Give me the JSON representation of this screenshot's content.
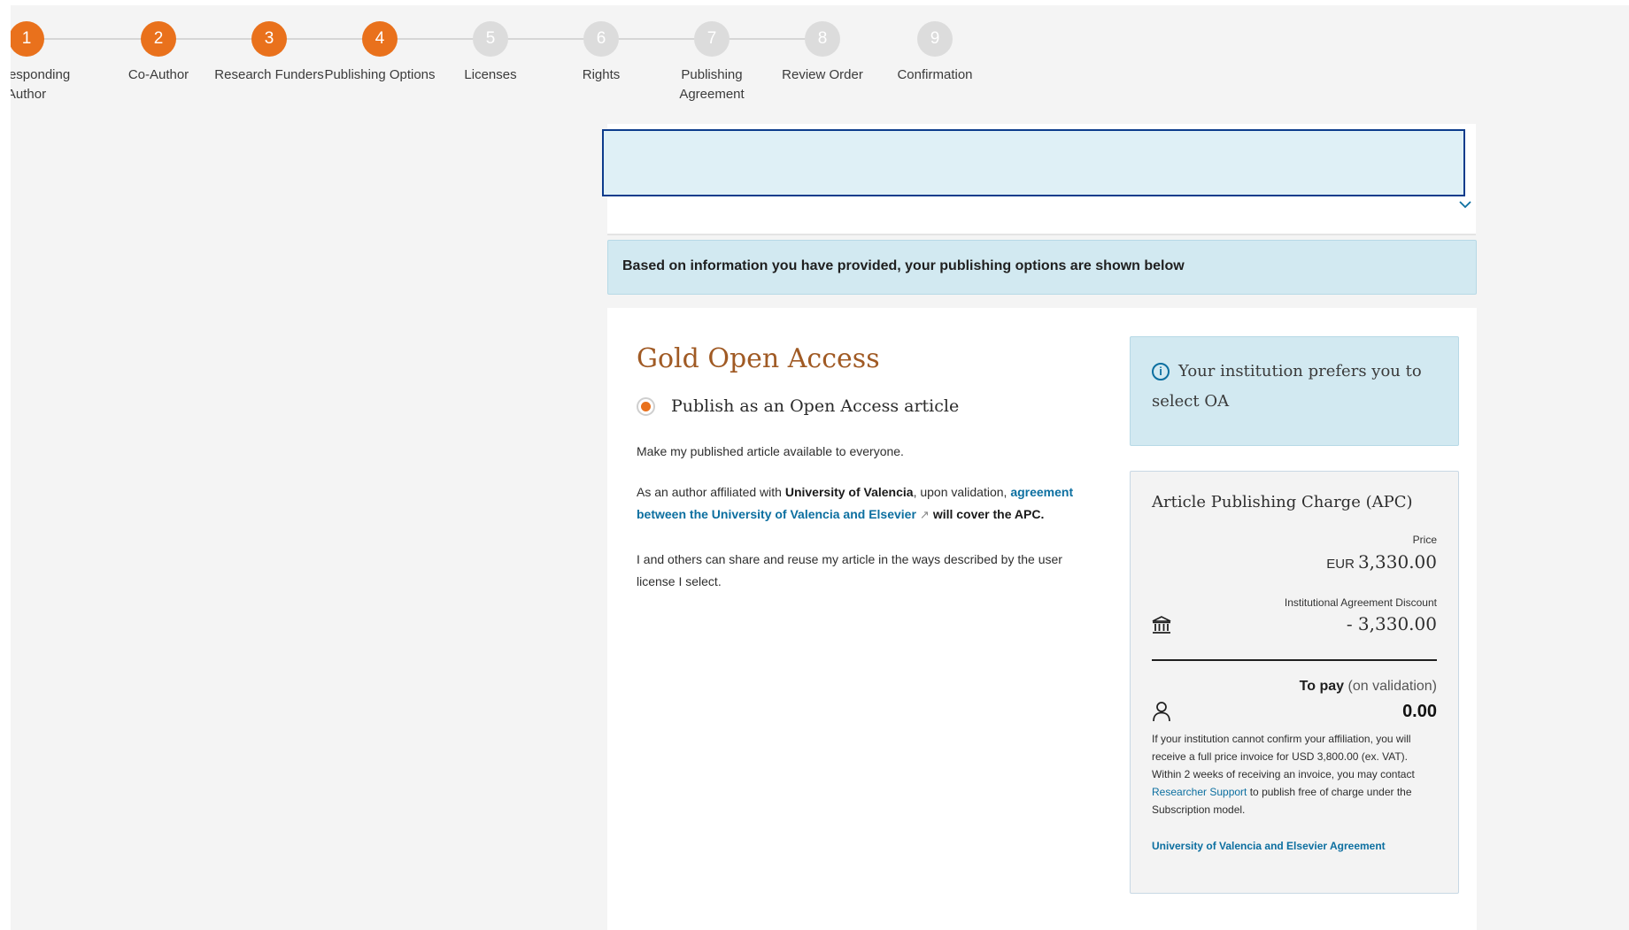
{
  "stepper": {
    "steps": [
      {
        "num": "1",
        "label": "Corresponding Author",
        "state": "done"
      },
      {
        "num": "2",
        "label": "Co-Author",
        "state": "done"
      },
      {
        "num": "3",
        "label": "Research Funders",
        "state": "done"
      },
      {
        "num": "4",
        "label": "Publishing Options",
        "state": "current"
      },
      {
        "num": "5",
        "label": "Licenses",
        "state": "todo"
      },
      {
        "num": "6",
        "label": "Rights",
        "state": "todo"
      },
      {
        "num": "7",
        "label": "Publishing Agreement",
        "state": "todo"
      },
      {
        "num": "8",
        "label": "Review Order",
        "state": "todo"
      },
      {
        "num": "9",
        "label": "Confirmation",
        "state": "todo"
      }
    ]
  },
  "banner": {
    "text": "Based on information you have provided, your publishing options are shown below"
  },
  "option": {
    "title": "Gold Open Access",
    "radio_label": "Publish as an Open Access article",
    "desc1": "Make my published article available to everyone.",
    "desc2_a": "As an author affiliated with ",
    "desc2_b": "University of Valencia",
    "desc2_c": ", upon validation, ",
    "desc2_link": "agreement between the University of Valencia and Elsevier",
    "desc2_d": "will cover the APC.",
    "desc3": "I and others can share and reuse my article in the ways described by the user license I select."
  },
  "preference": {
    "text": "Your institution prefers you to select OA"
  },
  "apc": {
    "title": "Article Publishing Charge (APC)",
    "price_label": "Price",
    "currency": "EUR",
    "price": "3,330.00",
    "discount_label": "Institutional Agreement Discount",
    "discount": "- 3,330.00",
    "to_pay": "To pay",
    "to_pay_note": "(on validation)",
    "total": "0.00",
    "fine_a": "If your institution cannot confirm your affiliation, you will receive a full price invoice for USD 3,800.00 (ex. VAT). Within 2 weeks of receiving an invoice, you may contact ",
    "fine_link": "Researcher Support",
    "fine_b": " to publish free of charge under the Subscription model.",
    "agreement_link": "University of Valencia and Elsevier Agreement"
  },
  "colors": {
    "accent": "#e9711c",
    "link": "#0c6fa0",
    "info_bg": "#d2e9f1",
    "title_brown": "#a05a24"
  }
}
